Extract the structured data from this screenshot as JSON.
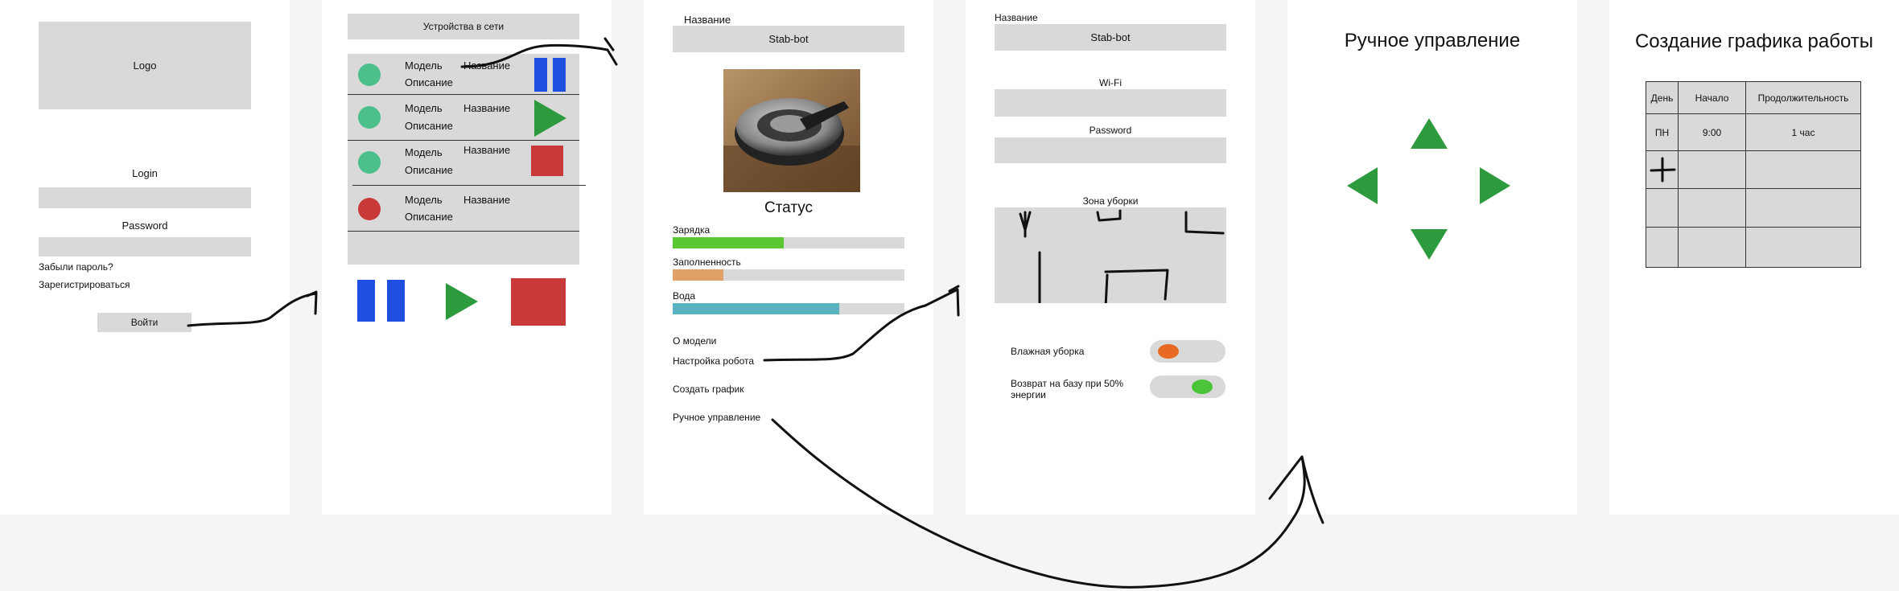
{
  "login_screen": {
    "logo_label": "Logo",
    "login_label": "Login",
    "password_label": "Password",
    "forgot_link": "Забыли пароль?",
    "register_link": "Зарегистрироваться",
    "submit_button": "Войти"
  },
  "devices_screen": {
    "header": "Устройства в сети",
    "devices": [
      {
        "model": "Модель",
        "name": "Название",
        "description": "Описание",
        "status_color": "#4cbf8b",
        "action_icon": "pause-icon",
        "action_color": "#1f4fe0"
      },
      {
        "model": "Модель",
        "name": "Название",
        "description": "Описание",
        "status_color": "#4cbf8b",
        "action_icon": "play-icon",
        "action_color": "#2e9a3e"
      },
      {
        "model": "Модель",
        "name": "Название",
        "description": "Описание",
        "status_color": "#4cbf8b",
        "action_icon": "stop-icon",
        "action_color": "#c83a3a"
      },
      {
        "model": "Модель",
        "name": "Название",
        "description": "Описание",
        "status_color": "#c83a3a",
        "action_icon": "",
        "action_color": ""
      }
    ],
    "controls": [
      "pause-icon",
      "play-icon",
      "stop-icon"
    ]
  },
  "robot_screen": {
    "name_label": "Название",
    "name_value": "Stab-bot",
    "status_title": "Статус",
    "metrics": [
      {
        "label": "Зарядка",
        "fraction": 0.48,
        "color": "#5ac832"
      },
      {
        "label": "Заполненность",
        "fraction": 0.22,
        "color": "#e0a066"
      },
      {
        "label": "Вода",
        "fraction": 0.72,
        "color": "#5ab4c0"
      }
    ],
    "menu": [
      "О модели",
      "Настройка робота",
      "Создать график",
      "Ручное управление"
    ]
  },
  "settings_screen": {
    "name_label": "Название",
    "name_value": "Stab-bot",
    "wifi_label": "Wi-Fi",
    "password_label": "Password",
    "zone_label": "Зона уборки",
    "toggles": [
      {
        "label": "Влажная уборка",
        "on": false,
        "color": "#e86a22"
      },
      {
        "label": "Возврат на базу при 50% энергии",
        "on": true,
        "color": "#4cc43a"
      }
    ]
  },
  "manual_screen": {
    "title": "Ручное управление",
    "arrow_color": "#2e9a3e"
  },
  "schedule_screen": {
    "title": "Создание графика работы",
    "headers": [
      "День",
      "Начало",
      "Продолжительность"
    ],
    "rows": [
      [
        "ПН",
        "9:00",
        "1 час"
      ]
    ]
  }
}
